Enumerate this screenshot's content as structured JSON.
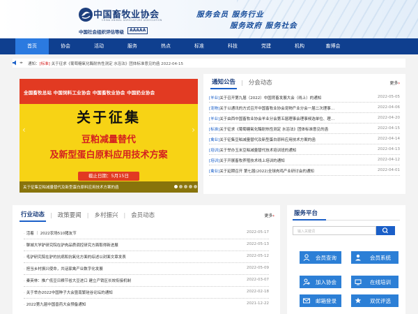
{
  "header": {
    "org_name": "中国畜牧业协会",
    "org_en": "CHINA ANIMAL AGRICULTURE ASSOCIATION",
    "rating_label": "中国社会组织评估等级",
    "rating_value": "AAAAA",
    "slogan_line1": "服务会员 服务行业",
    "slogan_line2": "服务政府 服务社会"
  },
  "nav": {
    "items": [
      {
        "label": "首页",
        "active": true
      },
      {
        "label": "协会"
      },
      {
        "label": "活动"
      },
      {
        "label": "服务"
      },
      {
        "label": "热点"
      },
      {
        "label": "标准"
      },
      {
        "label": "科技"
      },
      {
        "label": "党建"
      },
      {
        "label": "机构"
      },
      {
        "label": "畜博会"
      }
    ]
  },
  "notice": {
    "prefix": "通知：",
    "tag": "[标准]",
    "text": "关于征求《葡萄糖氧化酶耐热性测定 水浴法》团体标准意见的函",
    "date": "2022-04-15"
  },
  "banner": {
    "orgs": "全国畜牧总站  中国饲料工业协会  中国畜牧业协会  中国奶业协会",
    "headline": "关于征集",
    "sub1": "豆粕减量替代",
    "sub2": "及新型蛋白原料应用技术方案",
    "deadline": "截止日期：5月15日",
    "caption": "关于征集豆粕减量替代及新型蛋白原料应用技术方案的函",
    "slide_count": 5,
    "active_slide": 1
  },
  "notices_panel": {
    "tabs": [
      "通知公告",
      "分会动态"
    ],
    "more_label": "更多",
    "items": [
      {
        "tag": "[羊业]",
        "title": "关于召开第九届（2022）中国肾畜发展大会（线上）的通知",
        "date": "2022-05-05"
      },
      {
        "tag": "[宠物]",
        "title": "关于以通讯的方式召开中国畜牧业协会宠物产业分会一届二次理事…",
        "date": "2022-04-06"
      },
      {
        "tag": "[羊业]",
        "title": "关于由西中国畜牧业协会羊业分会第五届理事会理事候选单位、理…",
        "date": "2022-04-20"
      },
      {
        "tag": "[标准]",
        "title": "关于征求《葡萄糖氧化酶耐热性测定 水浴法》团体标准意见的函",
        "date": "2022-04-15"
      },
      {
        "tag": "[禽业]",
        "title": "关于征集豆粕减量替代及新型蛋白原料应用技术方案的函",
        "date": "2022-04-14"
      },
      {
        "tag": "[培训]",
        "title": "关于举办玉米豆粕减量替代技术培训班的通知",
        "date": "2022-04-13"
      },
      {
        "tag": "[培训]",
        "title": "关于开展畜牧养殖技术线上培训的通知",
        "date": "2022-04-12"
      },
      {
        "tag": "[禽业]",
        "title": "关于延期召开 第七届(2022)全球肉鸡产业研讨会的通知",
        "date": "2022-04-01"
      }
    ]
  },
  "industry_panel": {
    "tabs": [
      "行业动态",
      "政策要闻",
      "乡村振兴",
      "会员动态"
    ],
    "more_label": "更多",
    "items": [
      {
        "title": "活着 ｜ 2022农场510猪友节",
        "date": "2022-05-17"
      },
      {
        "title": "聊城大学驴研究院在驴肉品质调控研究方面取得新进展",
        "date": "2022-05-13"
      },
      {
        "title": "毛驴研究院在驴的抗病和抗氧化方面的综述以封面文章发表",
        "date": "2022-05-12"
      },
      {
        "title": "担当乡村振兴使命，共话家禽产业数字化发展",
        "date": "2022-05-09"
      },
      {
        "title": "秦英林：推广低豆日粮节省大豆进口 建立产销区长效衔接机制",
        "date": "2022-03-07"
      },
      {
        "title": "关于举办2022中国种子大会暨南繁硅谷论坛的通知",
        "date": "2022-02-18"
      },
      {
        "title": "2022第九届中国兽药大会预备通知",
        "date": "2021-12-22"
      }
    ]
  },
  "service_panel": {
    "title": "服务平台",
    "search_placeholder": "输入关键词",
    "buttons": [
      {
        "label": "会员查询",
        "icon": "member-search-icon"
      },
      {
        "label": "会员系统",
        "icon": "member-system-icon"
      },
      {
        "label": "加入协会",
        "icon": "join-icon"
      },
      {
        "label": "在线培训",
        "icon": "training-icon"
      },
      {
        "label": "邮箱登录",
        "icon": "mail-icon"
      },
      {
        "label": "双优评选",
        "icon": "award-icon"
      }
    ]
  },
  "colors": {
    "nav_bg": "#0f3f8f",
    "nav_active": "#2b7ae0",
    "accent_red": "#d42020",
    "service_button": "#2c7fd6"
  }
}
